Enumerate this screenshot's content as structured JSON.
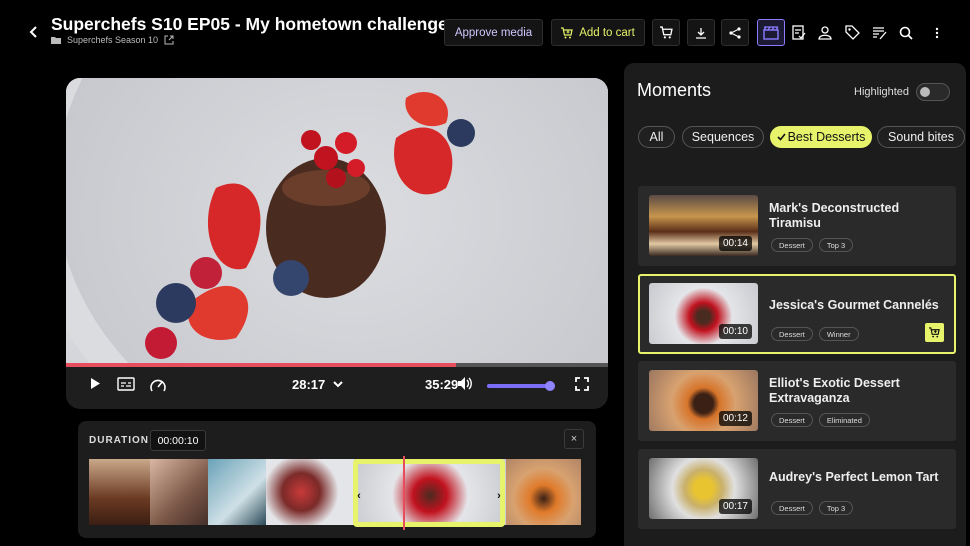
{
  "header": {
    "title": "Superchefs S10 EP05 - My hometown challenge",
    "breadcrumb": "Superchefs Season 10",
    "approve_label": "Approve media",
    "add_to_cart_label": "Add to cart",
    "icons": [
      "cart-icon",
      "download-icon",
      "share-icon",
      "clapper-icon",
      "notes-icon",
      "person-icon",
      "tag-icon",
      "transcript-icon",
      "search-icon",
      "more-icon"
    ]
  },
  "player": {
    "current_time": "28:17",
    "total_time": "35:29",
    "progress": 0.72,
    "volume": 0.93
  },
  "duration": {
    "label": "DURATION",
    "value": "00:00:10",
    "close": "×"
  },
  "moments": {
    "title": "Moments",
    "highlighted_label": "Highlighted",
    "highlighted_on": false,
    "filters": [
      {
        "label": "All",
        "active": false
      },
      {
        "label": "Sequences",
        "active": false
      },
      {
        "label": "Best Desserts",
        "active": true
      },
      {
        "label": "Sound bites",
        "active": false
      }
    ],
    "items": [
      {
        "name": "Mark's Deconstructed Tiramisu",
        "time": "00:14",
        "tags": [
          "Dessert",
          "Top 3"
        ],
        "selected": false
      },
      {
        "name": "Jessica's Gourmet Cannelés",
        "time": "00:10",
        "tags": [
          "Dessert",
          "Winner"
        ],
        "selected": true
      },
      {
        "name": "Elliot's Exotic Dessert Extravaganza",
        "time": "00:12",
        "tags": [
          "Dessert",
          "Eliminated"
        ],
        "selected": false
      },
      {
        "name": "Audrey's Perfect Lemon Tart",
        "time": "00:17",
        "tags": [
          "Dessert",
          "Top 3"
        ],
        "selected": false
      }
    ]
  },
  "colors": {
    "accent": "#e7f46b",
    "purple": "#8b7cff",
    "red": "#e74d5d"
  }
}
